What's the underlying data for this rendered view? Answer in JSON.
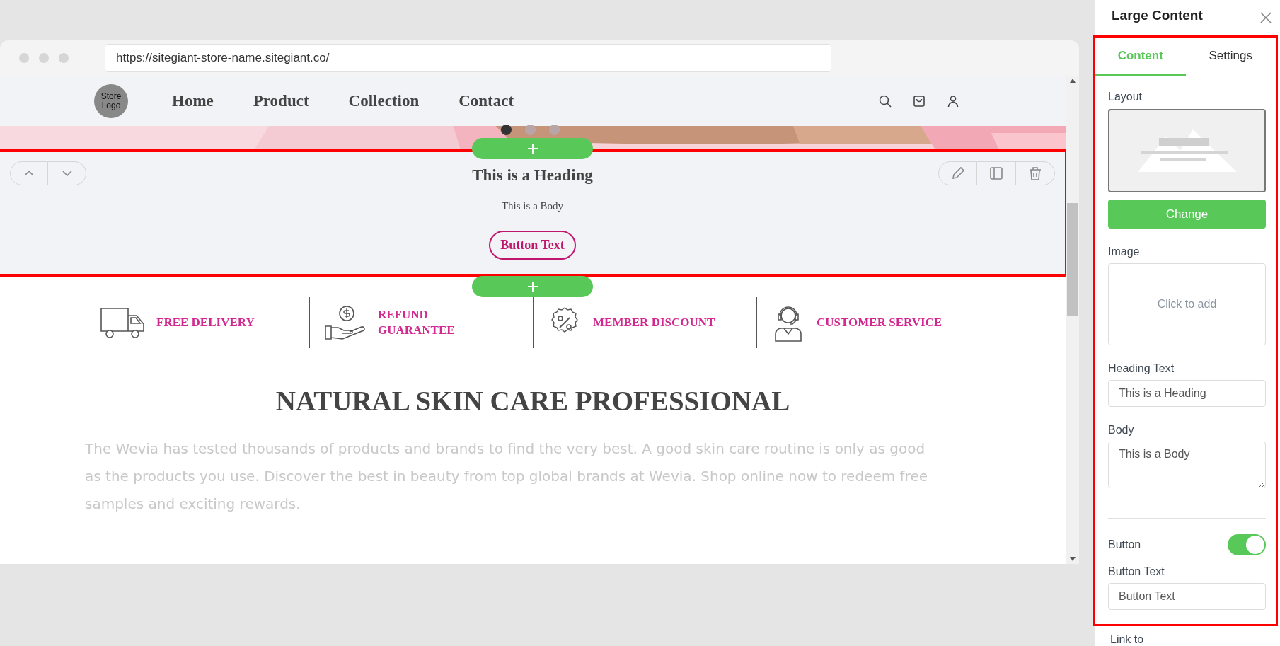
{
  "browser": {
    "url": "https://sitegiant-store-name.sitegiant.co/"
  },
  "nav": {
    "logo": "Store Logo",
    "links": [
      {
        "label": "Home"
      },
      {
        "label": "Product"
      },
      {
        "label": "Collection"
      },
      {
        "label": "Contact"
      }
    ]
  },
  "hero": {
    "slides": [
      {
        "selected": true
      },
      {
        "selected": false
      },
      {
        "selected": false
      }
    ]
  },
  "section": {
    "heading": "This is a Heading",
    "body": "This is a Body",
    "button": "Button Text"
  },
  "features": [
    {
      "kind": "delivery",
      "label": "FREE DELIVERY"
    },
    {
      "kind": "refund",
      "label": "REFUND\nGUARANTEE"
    },
    {
      "kind": "discount",
      "label": "MEMBER DISCOUNT"
    },
    {
      "kind": "service",
      "label": "CUSTOMER SERVICE"
    }
  ],
  "intro": {
    "heading": "NATURAL SKIN CARE PROFESSIONAL",
    "paragraph": "The Wevia has tested thousands of products and brands to find the very best. A good skin care routine is only as good as the products you use. Discover the best in beauty from top global brands at Wevia. Shop online now to redeem free samples and exciting rewards."
  },
  "panel": {
    "title": "Large Content",
    "tabs": [
      {
        "label": "Content",
        "selected": true
      },
      {
        "label": "Settings",
        "selected": false
      }
    ],
    "layout_label": "Layout",
    "change_button": "Change",
    "image_label": "Image",
    "image_placeholder": "Click to add",
    "heading_label": "Heading Text",
    "heading_value": "This is a Heading",
    "body_label": "Body",
    "body_value": "This is a Body",
    "button_label": "Button",
    "button_on": true,
    "button_text_label": "Button Text",
    "button_text_value": "Button Text",
    "link_label": "Link to"
  }
}
